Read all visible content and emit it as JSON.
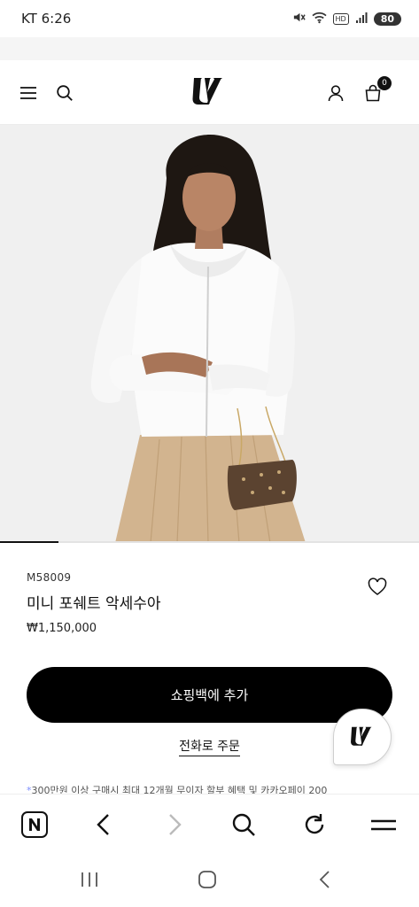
{
  "status_bar": {
    "carrier_time": "KT 6:26",
    "network_badge": "HD",
    "battery": "80",
    "icons": [
      "mute-icon",
      "wifi-icon",
      "hd-icon",
      "signal-icon",
      "battery-icon"
    ]
  },
  "header": {
    "logo_text": "LV",
    "cart_count": "0",
    "icons": [
      "menu-icon",
      "search-icon",
      "account-icon",
      "shopping-bag-icon"
    ]
  },
  "hero": {
    "gallery_progress": 0.14
  },
  "product": {
    "sku": "M58009",
    "name": "미니 포쉐트 악세수아",
    "price": "₩1,150,000",
    "add_to_cart_label": "쇼핑백에 추가",
    "phone_order_label": "전화로 주문"
  },
  "notice": {
    "asterisk": "*",
    "text": "300만원 이상 구매시 최대 12개월 무이자 할부 혜택 및 카카오페이 200"
  },
  "browser_bar": {
    "icons": [
      "naver-home-icon",
      "back-arrow-icon",
      "forward-arrow-icon",
      "search-icon",
      "reload-icon",
      "menu-icon"
    ]
  },
  "system_nav": {
    "icons": [
      "recent-apps-icon",
      "home-icon",
      "back-icon"
    ]
  },
  "colors": {
    "primary_button": "#000000",
    "accent_asterisk": "#7a8cff"
  }
}
